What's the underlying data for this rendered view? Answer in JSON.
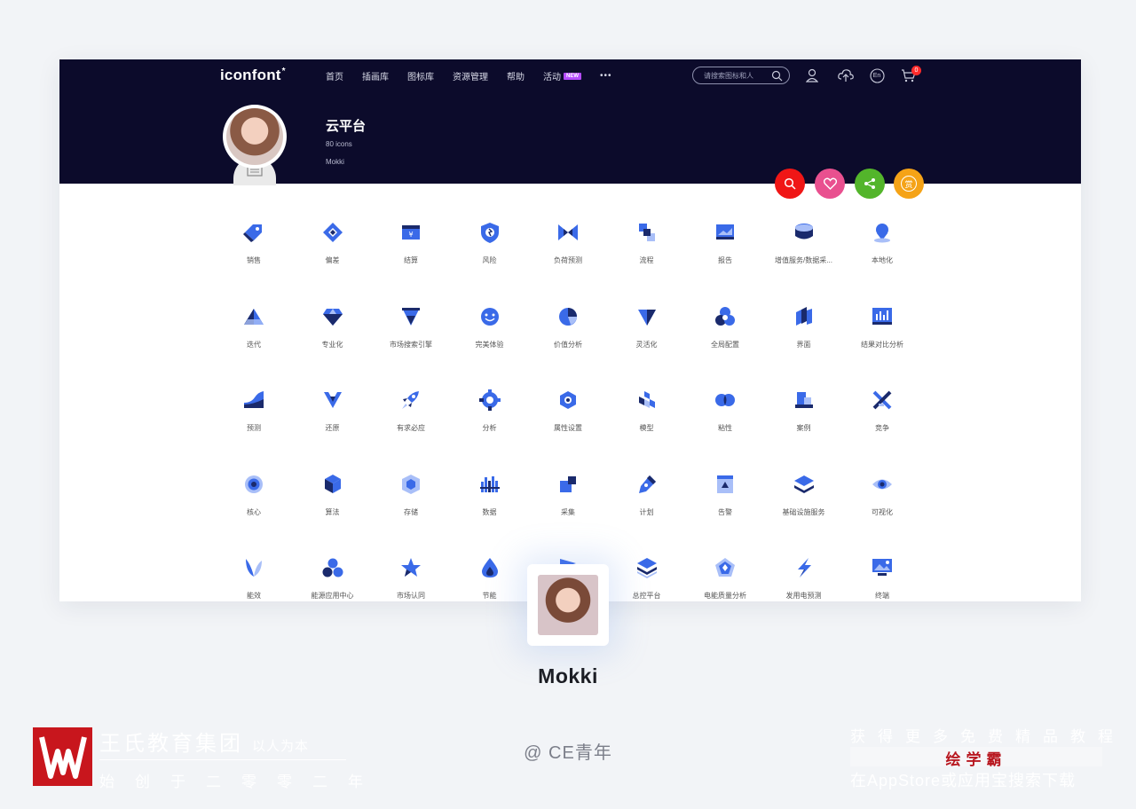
{
  "header": {
    "logo": "iconfont",
    "nav": [
      "首页",
      "插画库",
      "图标库",
      "资源管理",
      "帮助",
      "活动"
    ],
    "new_badge": "NEW",
    "more": "•••",
    "search_placeholder": "请搜索图标和人",
    "lang": "En",
    "cart_count": "0"
  },
  "project": {
    "title": "云平台",
    "count": "80 icons",
    "author": "Mokki"
  },
  "actions": [
    {
      "name": "search",
      "color": "#f01616"
    },
    {
      "name": "favorite",
      "color": "#e9508f"
    },
    {
      "name": "share",
      "color": "#53b52b"
    },
    {
      "name": "reward",
      "color": "#f5a317",
      "glyph": "赏"
    }
  ],
  "icons": [
    {
      "label": "销售",
      "icon": "tag"
    },
    {
      "label": "偏差",
      "icon": "diamond-check"
    },
    {
      "label": "结算",
      "icon": "yen-card"
    },
    {
      "label": "风险",
      "icon": "shield"
    },
    {
      "label": "负荷预测",
      "icon": "bowtie"
    },
    {
      "label": "流程",
      "icon": "flow"
    },
    {
      "label": "报告",
      "icon": "monitor-chart"
    },
    {
      "label": "增值服务/数据采...",
      "icon": "database"
    },
    {
      "label": "本地化",
      "icon": "location"
    },
    {
      "label": "迭代",
      "icon": "pyramid"
    },
    {
      "label": "专业化",
      "icon": "gem"
    },
    {
      "label": "市场搜索引擎",
      "icon": "funnel"
    },
    {
      "label": "完美体验",
      "icon": "smile"
    },
    {
      "label": "价值分析",
      "icon": "pie"
    },
    {
      "label": "灵活化",
      "icon": "triangle-down"
    },
    {
      "label": "全局配置",
      "icon": "cluster"
    },
    {
      "label": "界面",
      "icon": "layers-vertical"
    },
    {
      "label": "结果对比分析",
      "icon": "bar-board"
    },
    {
      "label": "预测",
      "icon": "area"
    },
    {
      "label": "还原",
      "icon": "triangle-split"
    },
    {
      "label": "有求必应",
      "icon": "rocket"
    },
    {
      "label": "分析",
      "icon": "gear"
    },
    {
      "label": "属性设置",
      "icon": "hexagon-gear"
    },
    {
      "label": "模型",
      "icon": "cubes"
    },
    {
      "label": "粘性",
      "icon": "overlap-circles"
    },
    {
      "label": "案例",
      "icon": "blocks"
    },
    {
      "label": "竞争",
      "icon": "swords"
    },
    {
      "label": "核心",
      "icon": "target"
    },
    {
      "label": "算法",
      "icon": "cube"
    },
    {
      "label": "存储",
      "icon": "hex-box"
    },
    {
      "label": "数据",
      "icon": "bars"
    },
    {
      "label": "采集",
      "icon": "squares"
    },
    {
      "label": "计划",
      "icon": "pen"
    },
    {
      "label": "告警",
      "icon": "alarm-box"
    },
    {
      "label": "基础设施服务",
      "icon": "stack"
    },
    {
      "label": "可视化",
      "icon": "eye"
    },
    {
      "label": "能效",
      "icon": "leaf"
    },
    {
      "label": "能源应用中心",
      "icon": "three-circles"
    },
    {
      "label": "市场认同",
      "icon": "star"
    },
    {
      "label": "节能",
      "icon": "drop"
    },
    {
      "label": "",
      "icon": "arrow-flag"
    },
    {
      "label": "总控平台",
      "icon": "layers"
    },
    {
      "label": "电能质量分析",
      "icon": "pentagon"
    },
    {
      "label": "发用电预测",
      "icon": "bolt"
    },
    {
      "label": "终端",
      "icon": "monitor-photo"
    }
  ],
  "author_card": {
    "name": "Mokki"
  },
  "footer": {
    "brand": "王氏教育集团",
    "slogan": "以人为本",
    "tagline": "始创于二零零二年",
    "credit": "@ CE青年",
    "promo_top": "获得更多免费精品教程",
    "promo_app": "绘学霸",
    "promo_bottom": "在AppStore或应用宝搜索下载"
  },
  "colors": {
    "hero_bg": "#0c0b2b",
    "icon_primary": "#3a6ae8",
    "icon_dark": "#1a2a6c",
    "icon_light": "#a9bff8"
  }
}
